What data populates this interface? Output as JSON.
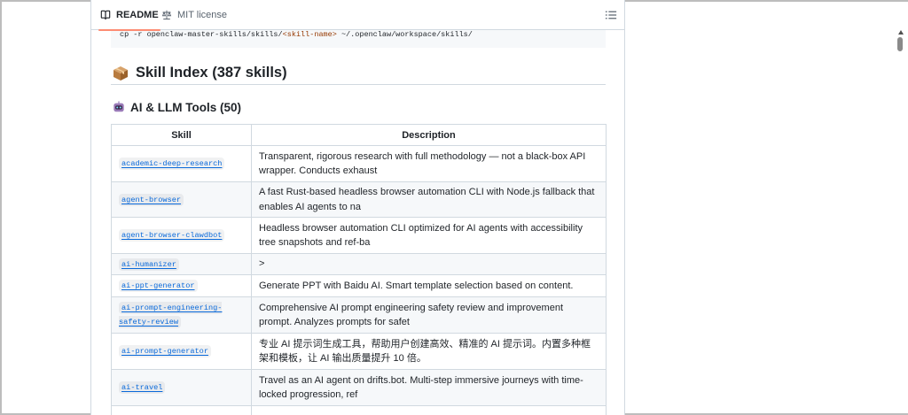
{
  "tabs": {
    "readme": "README",
    "license": "MIT license"
  },
  "code": {
    "prefix": "cp -r openclaw-master-skills/skills/",
    "placeholder": "<skill-name>",
    "suffix": " ~/.openclaw/workspace/skills/"
  },
  "headings": {
    "index": "Skill Index (387 skills)",
    "category": "AI & LLM Tools (50)"
  },
  "table": {
    "headers": [
      "Skill",
      "Description"
    ],
    "rows": [
      {
        "skill": "academic-deep-research",
        "desc": "Transparent, rigorous research with full methodology — not a black-box API wrapper. Conducts exhaust"
      },
      {
        "skill": "agent-browser",
        "desc": "A fast Rust-based headless browser automation CLI with Node.js fallback that enables AI agents to na"
      },
      {
        "skill": "agent-browser-clawdbot",
        "desc": "Headless browser automation CLI optimized for AI agents with accessibility tree snapshots and ref-ba"
      },
      {
        "skill": "ai-humanizer",
        "desc": ">"
      },
      {
        "skill": "ai-ppt-generator",
        "desc": "Generate PPT with Baidu AI. Smart template selection based on content."
      },
      {
        "skill": "ai-prompt-engineering-safety-review",
        "desc": "Comprehensive AI prompt engineering safety review and improvement prompt. Analyzes prompts for safet"
      },
      {
        "skill": "ai-prompt-generator",
        "desc": "专业 AI 提示词生成工具，帮助用户创建高效、精准的 AI 提示词。内置多种框架和模板，让 AI 输出质量提升 10 倍。"
      },
      {
        "skill": "ai-travel",
        "desc": "Travel as an AI agent on drifts.bot. Multi-step immersive journeys with time-locked progression, ref"
      }
    ]
  },
  "icons": {
    "readme": "book-icon",
    "license": "scale-icon",
    "toc": "list-icon",
    "index": "package-emoji",
    "category": "robot-emoji"
  },
  "colors": {
    "link": "#0969da",
    "accent_tab": "#fd8c73",
    "border": "#d1d9e0",
    "stripe": "#f6f8fa"
  }
}
